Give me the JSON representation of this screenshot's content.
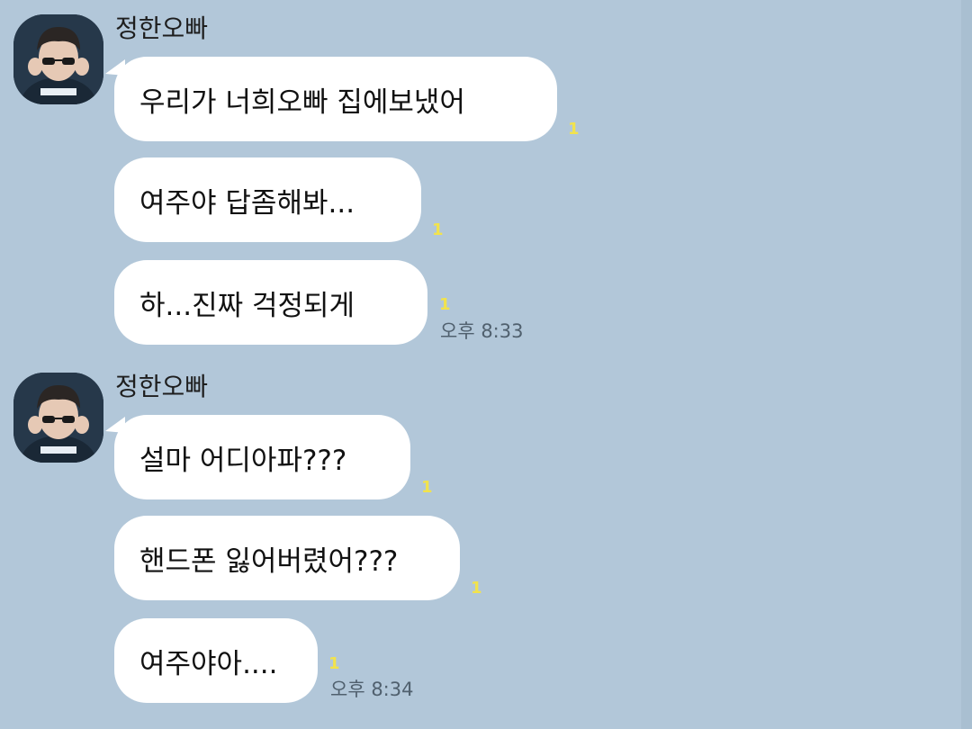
{
  "colors": {
    "background": "#b2c7d9",
    "bubble": "#ffffff",
    "unread_badge": "#f2e34c",
    "timestamp": "#50606e"
  },
  "groups": [
    {
      "sender": "정한오빠",
      "avatar_icon": "profile-photo",
      "messages": [
        {
          "text": "우리가 너희오빠 집에보냈어",
          "unread": "1"
        },
        {
          "text": "여주야 답좀해봐...",
          "unread": "1"
        },
        {
          "text": "하...진짜 걱정되게",
          "unread": "1",
          "time": "오후 8:33"
        }
      ]
    },
    {
      "sender": "정한오빠",
      "avatar_icon": "profile-photo",
      "messages": [
        {
          "text": "설마 어디아파???",
          "unread": "1"
        },
        {
          "text": "핸드폰 잃어버렸어???",
          "unread": "1"
        },
        {
          "text": "여주야아....",
          "unread": "1",
          "time": "오후 8:34"
        }
      ]
    }
  ]
}
